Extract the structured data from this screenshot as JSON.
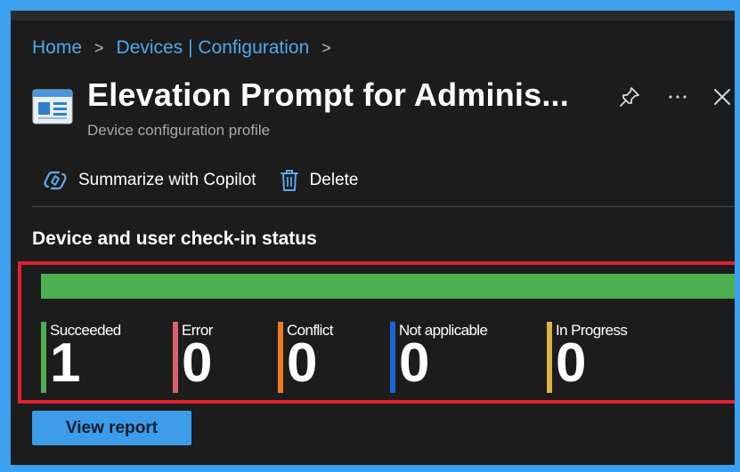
{
  "breadcrumb": {
    "items": [
      "Home",
      "Devices | Configuration"
    ],
    "separator": ">"
  },
  "header": {
    "title": "Elevation Prompt for Adminis...",
    "subtitle": "Device configuration profile",
    "icons": [
      "profile-icon",
      "pin-icon",
      "more-icon",
      "close-icon"
    ]
  },
  "toolbar": {
    "summarize_label": "Summarize with Copilot",
    "delete_label": "Delete"
  },
  "section": {
    "title": "Device and user check-in status"
  },
  "status": {
    "success_fraction": 1.0,
    "items": [
      {
        "label": "Succeeded",
        "value": "1",
        "color": "#4caf50"
      },
      {
        "label": "Error",
        "value": "0",
        "color": "#d9626c"
      },
      {
        "label": "Conflict",
        "value": "0",
        "color": "#f07c22"
      },
      {
        "label": "Not applicable",
        "value": "0",
        "color": "#1a66d9"
      },
      {
        "label": "In Progress",
        "value": "0",
        "color": "#d8b447"
      }
    ]
  },
  "actions": {
    "view_report_label": "View report"
  },
  "colors": {
    "accent": "#4ea8ef",
    "highlight_border": "#e0202e",
    "frame": "#3aa0ef",
    "background": "#1c1c1c"
  }
}
